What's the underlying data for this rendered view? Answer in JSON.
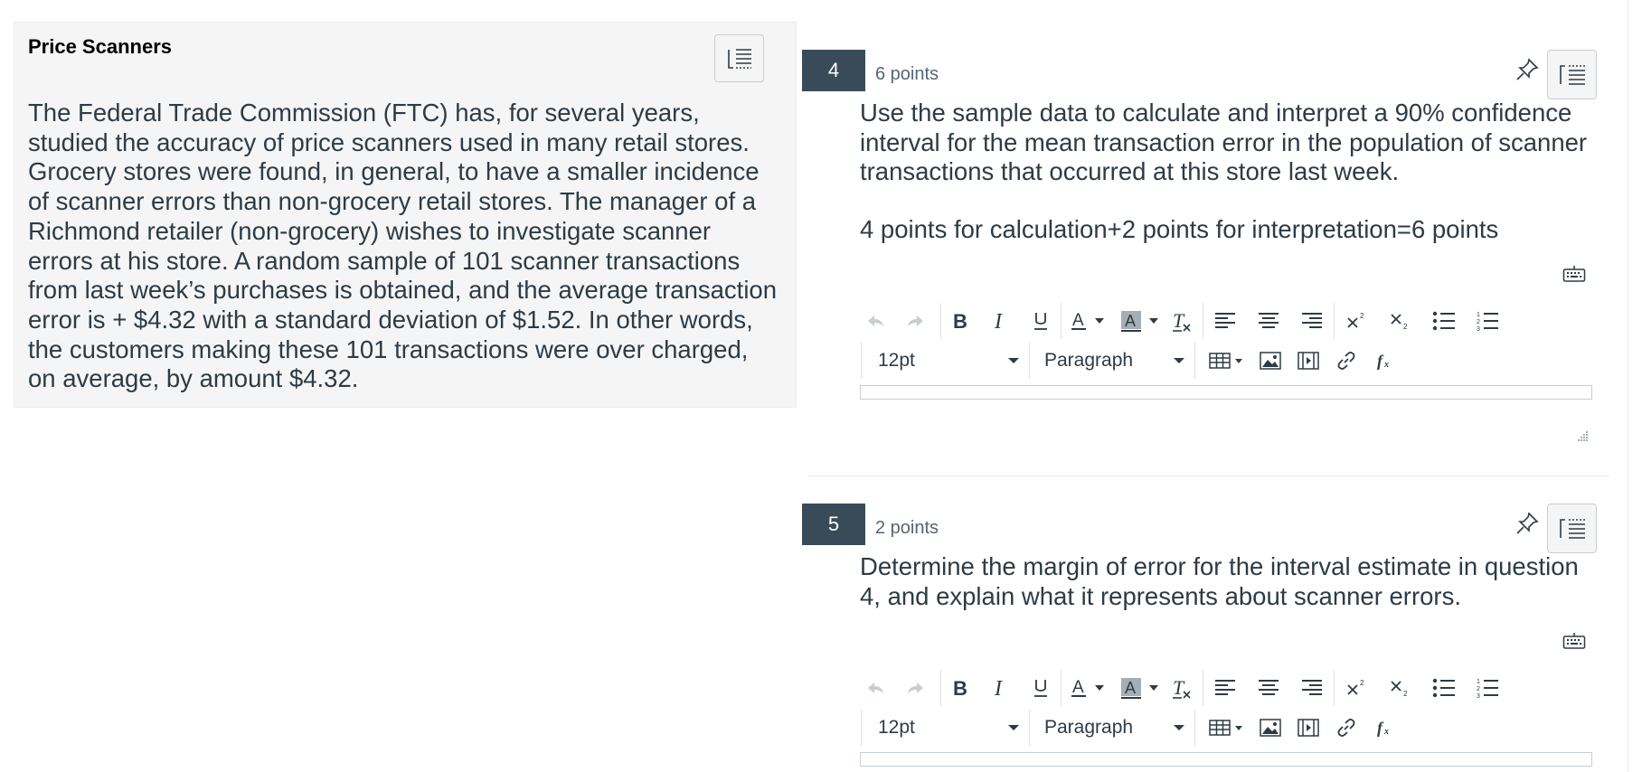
{
  "stimulus": {
    "title": "Price Scanners",
    "text": "The Federal Trade Commission (FTC) has, for several years, studied the accuracy of price scanners used in many retail stores. Grocery stores were found, in general, to have a smaller incidence of scanner errors than non-grocery retail stores. The manager of a Richmond retailer (non-grocery) wishes to investigate scanner errors at his store. A random sample of 101 scanner transactions from last week’s purchases is obtained, and the average transaction error is + $4.32 with a standard deviation of $1.52. In other words, the customers making these 101 transactions were over charged, on average, by amount $4.32."
  },
  "questions": [
    {
      "number": "4",
      "points": "6 points",
      "text": "Use the sample data to calculate and interpret a 90% confidence interval for the mean transaction error in the population of scanner transactions that occurred at this store last week.",
      "note": "4 points for calculation+2 points for interpretation=6 points",
      "font_size": "12pt",
      "block_format": "Paragraph"
    },
    {
      "number": "5",
      "points": "2 points",
      "text": "Determine the margin of error for the interval estimate in question 4, and explain what it represents about scanner errors.",
      "font_size": "12pt",
      "block_format": "Paragraph"
    }
  ],
  "icons": {
    "toolbar": [
      "undo-icon",
      "redo-icon",
      "bold-icon",
      "italic-icon",
      "underline-icon",
      "text-color-icon",
      "highlight-color-icon",
      "clear-formatting-icon",
      "align-left-icon",
      "align-center-icon",
      "align-right-icon",
      "superscript-icon",
      "subscript-icon",
      "bullet-list-icon",
      "numbered-list-icon",
      "table-icon",
      "image-icon",
      "media-icon",
      "link-icon",
      "equation-icon"
    ],
    "other": [
      "flag-list-icon",
      "pin-icon",
      "keyboard-icon",
      "resize-handle-icon"
    ]
  },
  "colors": {
    "question_badge": "#394b58",
    "stimulus_background": "#f5f5f5",
    "text": "#2d3b45"
  }
}
